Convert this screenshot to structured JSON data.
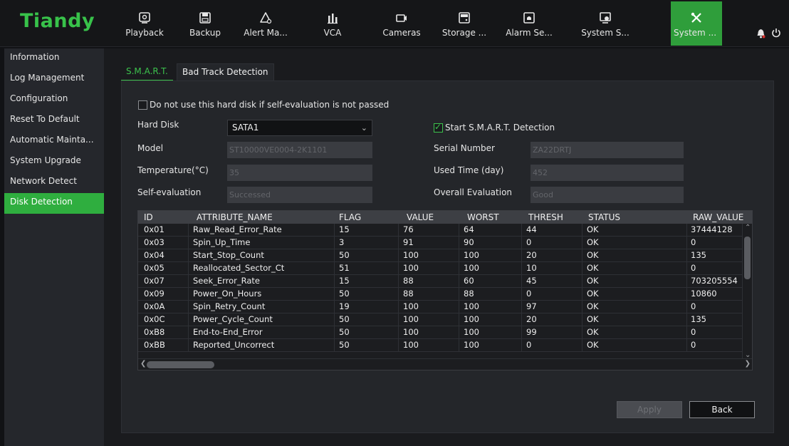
{
  "app": {
    "logo": "Tiandy",
    "brand_color": "#38c24a",
    "accent_color": "#2fae3f"
  },
  "nav": {
    "items": [
      {
        "label": "Playback",
        "icon": "playback-icon"
      },
      {
        "label": "Backup",
        "icon": "backup-icon"
      },
      {
        "label": "Alert Ma...",
        "icon": "alert-icon"
      },
      {
        "label": "VCA",
        "icon": "vca-icon"
      },
      {
        "label": "Cameras",
        "icon": "camera-icon"
      },
      {
        "label": "Storage ...",
        "icon": "storage-icon"
      },
      {
        "label": "Alarm Se...",
        "icon": "alarm-icon"
      },
      {
        "label": "System S...",
        "icon": "system-settings-icon"
      },
      {
        "label": "System ...",
        "icon": "tools-icon",
        "active": true
      }
    ]
  },
  "sidebar": {
    "items": [
      {
        "label": "Information"
      },
      {
        "label": "Log Management"
      },
      {
        "label": "Configuration"
      },
      {
        "label": "Reset To Default"
      },
      {
        "label": "Automatic Mainta..."
      },
      {
        "label": "System Upgrade"
      },
      {
        "label": "Network Detect"
      },
      {
        "label": "Disk Detection",
        "active": true
      }
    ]
  },
  "tabs": [
    {
      "label": "S.M.A.R.T.",
      "active": true
    },
    {
      "label": "Bad Track Detection",
      "active": false
    }
  ],
  "form": {
    "skip_disk_label": "Do not use this hard disk if self-evaluation is not passed",
    "skip_disk_checked": false,
    "hard_disk_label": "Hard Disk",
    "hard_disk_value": "SATA1",
    "start_smart_label": "Start S.M.A.R.T. Detection",
    "start_smart_checked": true,
    "model_label": "Model",
    "model_value": "ST10000VE0004-2K1101",
    "serial_label": "Serial Number",
    "serial_value": "ZA22DRTJ",
    "temp_label": "Temperature(°C)",
    "temp_value": "35",
    "used_time_label": "Used Time (day)",
    "used_time_value": "452",
    "self_eval_label": "Self-evaluation",
    "self_eval_value": "Successed",
    "overall_label": "Overall Evaluation",
    "overall_value": "Good"
  },
  "table": {
    "columns": [
      "ID",
      "ATTRIBUTE_NAME",
      "FLAG",
      "VALUE",
      "WORST",
      "THRESH",
      "STATUS",
      "RAW_VALUE"
    ],
    "rows": [
      [
        "0x01",
        "Raw_Read_Error_Rate",
        "15",
        "76",
        "64",
        "44",
        "OK",
        "37444128"
      ],
      [
        "0x03",
        "Spin_Up_Time",
        "3",
        "91",
        "90",
        "0",
        "OK",
        "0"
      ],
      [
        "0x04",
        "Start_Stop_Count",
        "50",
        "100",
        "100",
        "20",
        "OK",
        "135"
      ],
      [
        "0x05",
        "Reallocated_Sector_Ct",
        "51",
        "100",
        "100",
        "10",
        "OK",
        "0"
      ],
      [
        "0x07",
        "Seek_Error_Rate",
        "15",
        "88",
        "60",
        "45",
        "OK",
        "703205554"
      ],
      [
        "0x09",
        "Power_On_Hours",
        "50",
        "88",
        "88",
        "0",
        "OK",
        "10860"
      ],
      [
        "0x0A",
        "Spin_Retry_Count",
        "19",
        "100",
        "100",
        "97",
        "OK",
        "0"
      ],
      [
        "0x0C",
        "Power_Cycle_Count",
        "50",
        "100",
        "100",
        "20",
        "OK",
        "135"
      ],
      [
        "0xB8",
        "End-to-End_Error",
        "50",
        "100",
        "100",
        "99",
        "OK",
        "0"
      ],
      [
        "0xBB",
        "Reported_Uncorrect",
        "50",
        "100",
        "100",
        "0",
        "OK",
        "0"
      ]
    ]
  },
  "buttons": {
    "apply": "Apply",
    "back": "Back"
  }
}
